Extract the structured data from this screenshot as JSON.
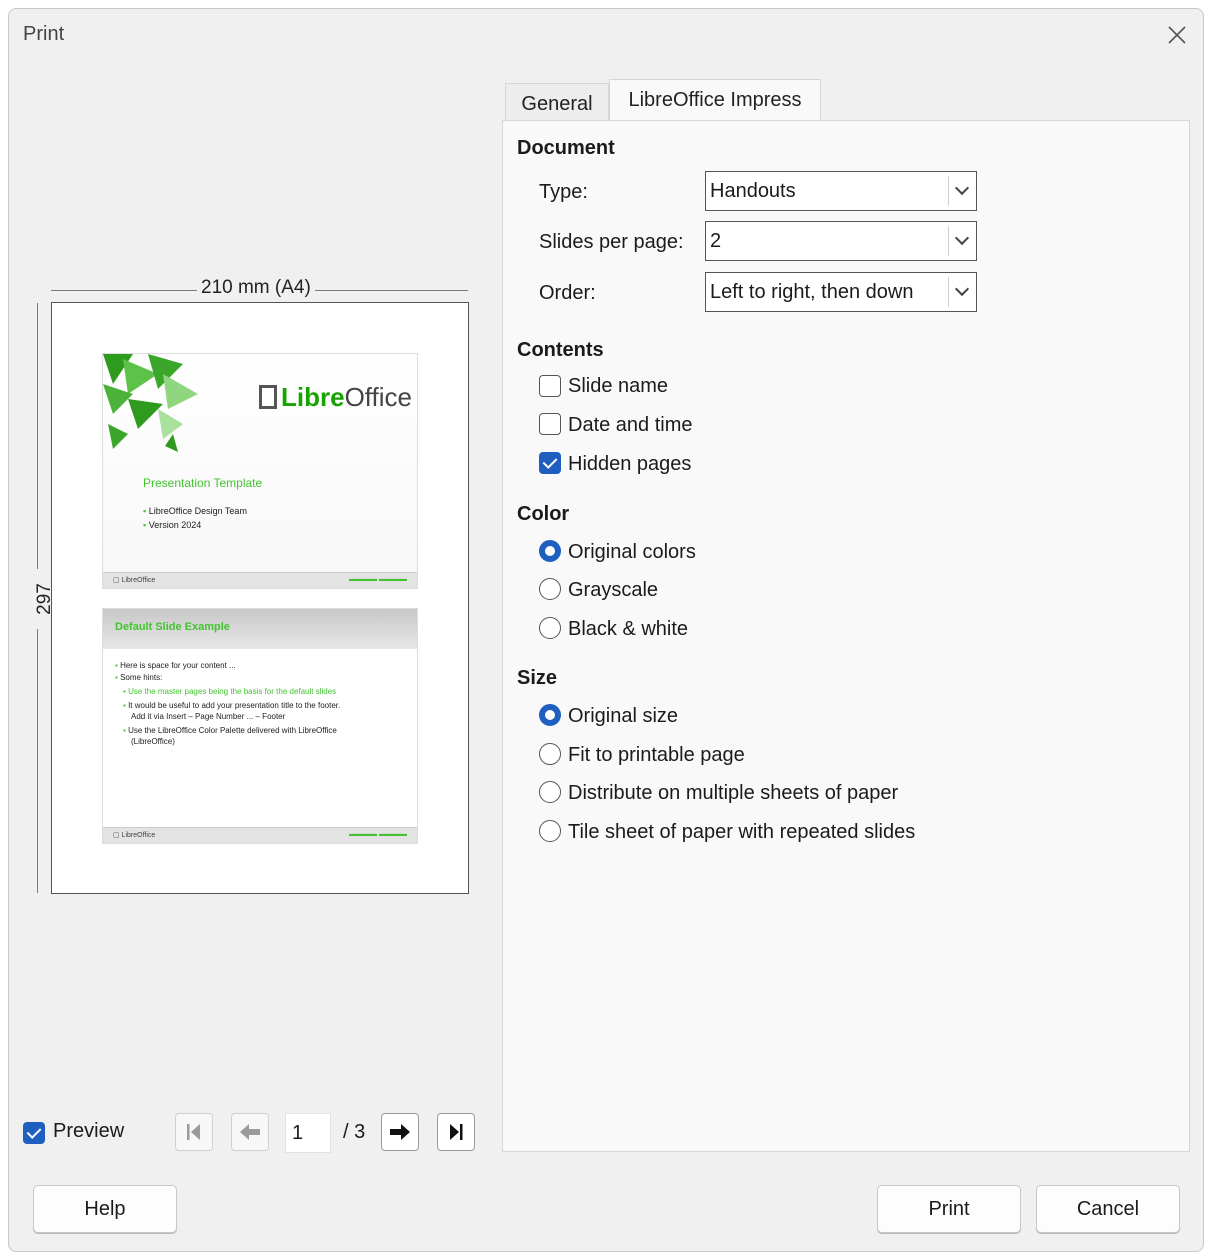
{
  "window": {
    "title": "Print"
  },
  "preview": {
    "width_label": "210 mm (A4)",
    "height_label": "297 mm",
    "slide1": {
      "logo_libre": "Libre",
      "logo_office": "Office",
      "title": "Presentation Template",
      "bullets": [
        "LibreOffice Design Team",
        "Version 2024"
      ]
    },
    "slide2": {
      "title": "Default Slide Example",
      "lines": [
        "Here is space for your content ...",
        "Some hints:",
        "Use the master pages being the basis for the default slides",
        "It would be useful to add your presentation title to the footer.",
        "Add it via Insert – Page Number ... – Footer",
        "Use the LibreOffice Color Palette delivered with LibreOffice",
        "(LibreOffice)"
      ]
    }
  },
  "preview_toggle": {
    "label": "Preview",
    "checked": true
  },
  "pager": {
    "current": "1",
    "total": "/ 3"
  },
  "tabs": [
    {
      "label": "General",
      "active": false
    },
    {
      "label": "LibreOffice Impress",
      "active": true
    }
  ],
  "document": {
    "heading": "Document",
    "type_label": "Type:",
    "type_value": "Handouts",
    "slides_label": "Slides per page:",
    "slides_value": "2",
    "order_label": "Order:",
    "order_value": "Left to right, then down"
  },
  "contents": {
    "heading": "Contents",
    "items": [
      {
        "label": "Slide name",
        "checked": false
      },
      {
        "label": "Date and time",
        "checked": false
      },
      {
        "label": "Hidden pages",
        "checked": true
      }
    ]
  },
  "color": {
    "heading": "Color",
    "options": [
      {
        "label": "Original colors",
        "selected": true
      },
      {
        "label": "Grayscale",
        "selected": false
      },
      {
        "label": "Black & white",
        "selected": false
      }
    ]
  },
  "size": {
    "heading": "Size",
    "options": [
      {
        "label": "Original size",
        "selected": true
      },
      {
        "label": "Fit to printable page",
        "selected": false
      },
      {
        "label": "Distribute on multiple sheets of paper",
        "selected": false
      },
      {
        "label": "Tile sheet of paper with repeated slides",
        "selected": false
      }
    ]
  },
  "buttons": {
    "help": "Help",
    "print": "Print",
    "cancel": "Cancel"
  },
  "colors": {
    "accent": "#1f5fbf",
    "libreoffice_green": "#43c330"
  }
}
